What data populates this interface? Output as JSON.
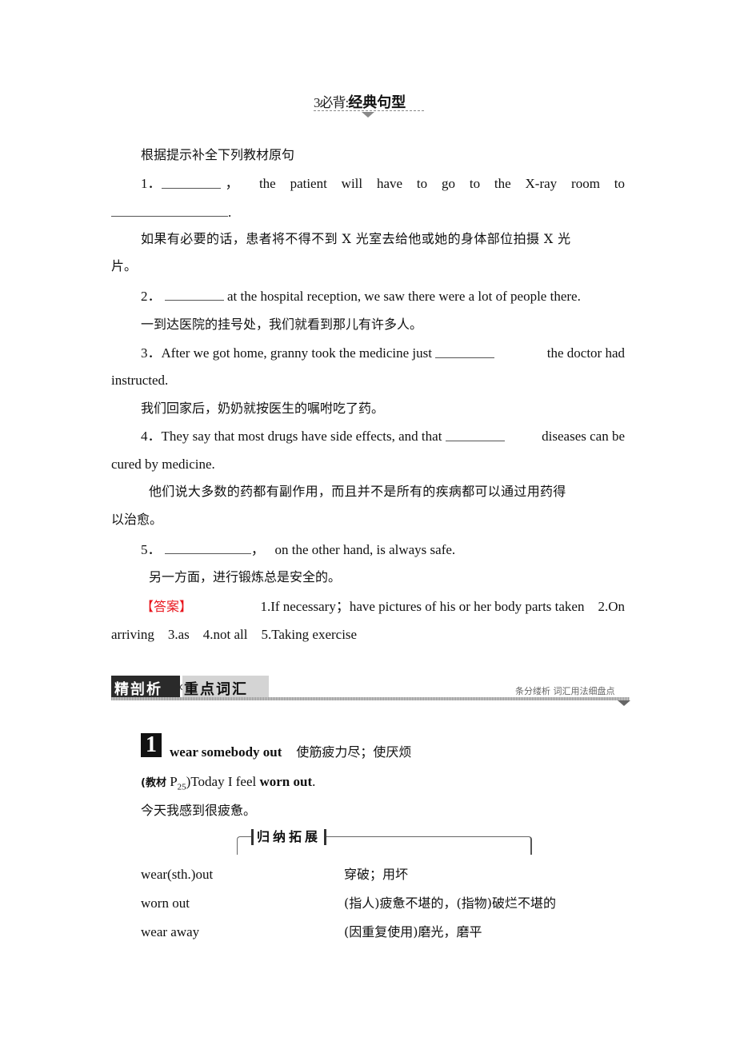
{
  "section_title": {
    "prefix": "3必背:",
    "main": "经典句型"
  },
  "instructions": "根据提示补全下列教材原句",
  "questions": [
    {
      "number": "1．",
      "line1_after_blank": "，      the patient will have to go to the X-ray room to",
      "line2_end": ".",
      "translation_line1": "如果有必要的话，患者将不得不到 X 光室去给他或她的身体部位拍摄 X 光",
      "translation_line2": "片。"
    },
    {
      "number": "2．",
      "after_blank": " at the hospital reception, we saw there were a lot of people there.",
      "translation": "一到达医院的挂号处，我们就看到那儿有许多人。"
    },
    {
      "number": "3．",
      "before_blank": "After we got home, granny took the medicine just ",
      "after_blank": " the doctor had",
      "line2": "instructed.",
      "translation": "我们回家后，奶奶就按医生的嘱咐吃了药。"
    },
    {
      "number": "4．",
      "before_blank": "They say that most drugs have side effects, and that ",
      "after_blank": " diseases can be",
      "line2": "cured by medicine.",
      "translation_line1": "他们说大多数的药都有副作用，而且并不是所有的疾病都可以通过用药得",
      "translation_line2": "以治愈。"
    },
    {
      "number": "5．",
      "after_blank": "，   on the other hand, is always safe.",
      "translation": "另一方面，进行锻炼总是安全的。"
    }
  ],
  "answer": {
    "tag": "【答案】",
    "line1": "1.If necessary；have pictures of his or her body parts taken    2.On",
    "line2": "arriving    3.as    4.not all    5.Taking exercise"
  },
  "banner": {
    "dark_label": "精剖析",
    "light_label": "重点词汇",
    "subtitle": "条分缕析  词汇用法细盘点"
  },
  "vocab_item": {
    "number": "1",
    "phrase": "wear somebody out",
    "meaning": "使筋疲力尽；使厌烦",
    "source_label": "(教材",
    "source_page": " P",
    "source_page_sub": "25",
    "example_before": ")Today I feel ",
    "example_bold": "worn out",
    "example_after": ".",
    "example_translation": "今天我感到很疲惫。"
  },
  "extension": {
    "title": "归纳拓展",
    "rows": [
      {
        "phrase": "wear(sth.)out",
        "meaning": "穿破；用坏"
      },
      {
        "phrase": "worn out",
        "meaning": "(指人)疲惫不堪的，(指物)破烂不堪的"
      },
      {
        "phrase": "wear away",
        "meaning": "(因重复使用)磨光，磨平"
      }
    ]
  }
}
